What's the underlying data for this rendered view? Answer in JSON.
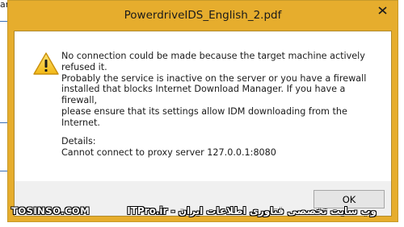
{
  "background": {
    "partial_text": "anual"
  },
  "dialog": {
    "title": "PowerdriveIDS_English_2.pdf",
    "message_lines": [
      "No connection could be made because the target machine actively",
      "refused it.",
      "Probably the service is inactive on the server or you have a firewall",
      "installed that blocks Internet Download Manager. If you have a firewall,",
      "please ensure that its settings allow IDM downloading from the",
      "Internet."
    ],
    "details_label": "Details:",
    "details_text": "Cannot connect to proxy server 127.0.0.1:8080",
    "ok_label": "OK"
  },
  "watermark": {
    "left": "TOSINSO.COM",
    "right": "ITPro.ir - وب سایت تخصصی فناوری اطلاعات ایران"
  },
  "colors": {
    "frame": "#e6ad2d",
    "button_bar": "#f0f0f0"
  },
  "icons": {
    "warning": "warning-icon",
    "close": "close-icon"
  }
}
